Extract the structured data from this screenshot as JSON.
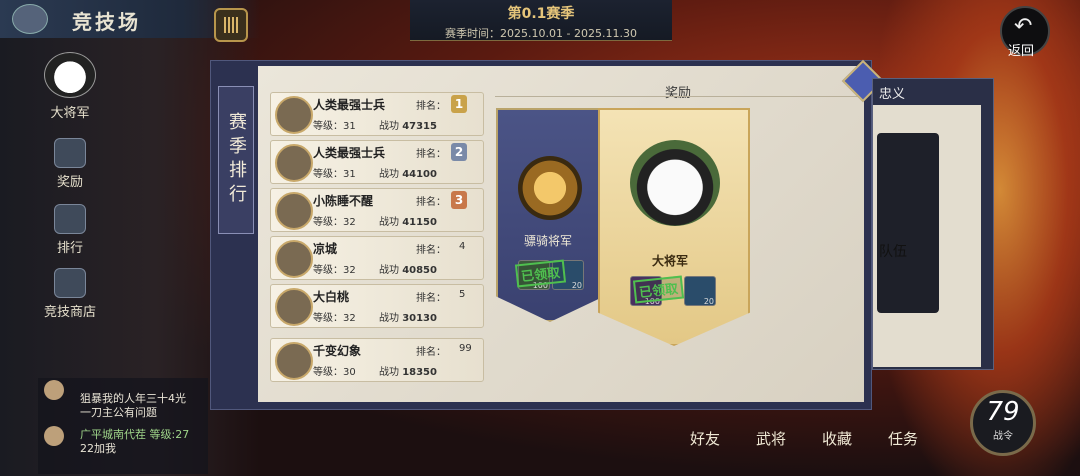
{
  "header": {
    "title": "竞技场",
    "season_name": "第0.1赛季",
    "season_time": "赛季时间：2025.10.01 - 2025.11.30",
    "back_label": "返回"
  },
  "sidebar": {
    "items": [
      {
        "label": "大将军",
        "icon": "panda-avatar-icon"
      },
      {
        "label": "奖励",
        "icon": "chest-icon"
      },
      {
        "label": "排行",
        "icon": "bar-chart-icon"
      },
      {
        "label": "竞技商店",
        "icon": "shop-icon"
      }
    ]
  },
  "ranking": {
    "tab_label": "赛季排行",
    "rank_prefix": "排名：",
    "level_prefix": "等级：",
    "power_prefix": "战功",
    "rows": [
      {
        "name": "人类最强士兵",
        "rank": "1",
        "level": "31",
        "power": "47315",
        "badge_color": "#c9a24a"
      },
      {
        "name": "人类最强士兵",
        "rank": "2",
        "level": "31",
        "power": "44100",
        "badge_color": "#7a8aa8"
      },
      {
        "name": "小陈睡不醒",
        "rank": "3",
        "level": "32",
        "power": "41150",
        "badge_color": "#c8784a"
      },
      {
        "name": "凉城",
        "rank": "4",
        "level": "32",
        "power": "40850",
        "badge_color": ""
      },
      {
        "name": "大白桃",
        "rank": "5",
        "level": "32",
        "power": "30130",
        "badge_color": ""
      },
      {
        "name": "千变幻象",
        "rank": "99",
        "level": "30",
        "power": "18350",
        "badge_color": ""
      }
    ]
  },
  "rewards": {
    "title": "奖励",
    "banners": [
      {
        "title": "骠骑将军",
        "emblem": "tiger-emblem-icon",
        "claimed_label": "已领取",
        "items": [
          {
            "count": "100"
          },
          {
            "count": "20"
          }
        ]
      },
      {
        "title": "大将军",
        "emblem": "panda-emblem-icon",
        "claimed_label": "已领取",
        "items": [
          {
            "count": "100"
          },
          {
            "count": "20"
          }
        ]
      }
    ]
  },
  "right_panel": {
    "title": "忠义",
    "body_text": "队伍"
  },
  "chat": {
    "line1": "狙暴我的人年三十4光",
    "line2": "一刀主公有问题",
    "line3_name": "广平城南代茬",
    "line3_level": "等级:27",
    "line4": "22加我"
  },
  "bottom_nav": {
    "items": [
      "好友",
      "武将",
      "收藏",
      "任务"
    ]
  },
  "player": {
    "level": "79",
    "level_label": "战令"
  },
  "colors": {
    "accent_gold": "#c9a55a",
    "panel_blue": "#3a3f63",
    "claimed_green": "#4fbf4f"
  }
}
